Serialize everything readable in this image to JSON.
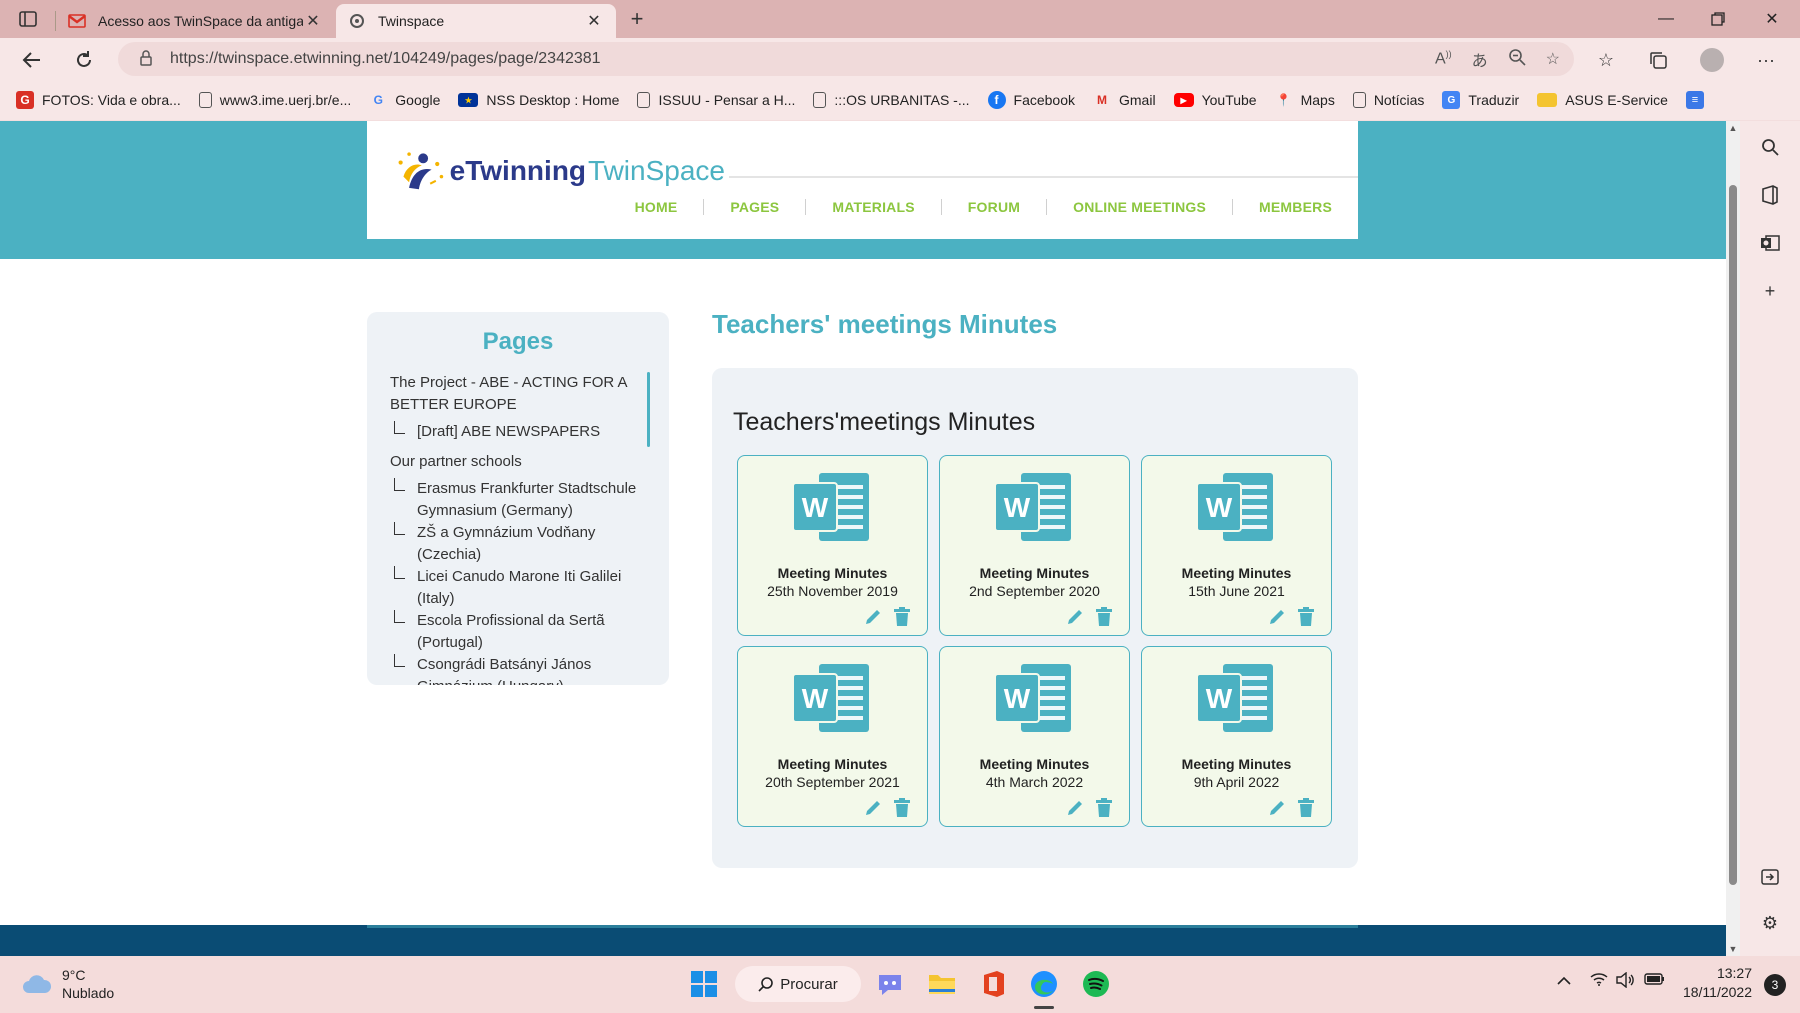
{
  "browser": {
    "tabs": [
      {
        "title": "Acesso aos TwinSpace da antiga",
        "favicon": "gmail-icon",
        "active": false
      },
      {
        "title": "Twinspace",
        "favicon": "twinspace-icon",
        "active": true
      }
    ],
    "url": "https://twinspace.etwinning.net/104249/pages/page/2342381",
    "bookmarks": [
      {
        "label": "FOTOS: Vida e obra...",
        "icon": "g-icon",
        "color": "#d93025"
      },
      {
        "label": "www3.ime.uerj.br/e...",
        "icon": "page-icon",
        "color": "#555555"
      },
      {
        "label": "Google",
        "icon": "google-icon",
        "color": "#4285f4"
      },
      {
        "label": "NSS Desktop : Home",
        "icon": "eu-flag-icon",
        "color": "#003399"
      },
      {
        "label": "ISSUU - Pensar a H...",
        "icon": "page-icon",
        "color": "#555555"
      },
      {
        "label": ":::OS URBANITAS -...",
        "icon": "page-icon",
        "color": "#555555"
      },
      {
        "label": "Facebook",
        "icon": "facebook-icon",
        "color": "#1877f2"
      },
      {
        "label": "Gmail",
        "icon": "gmail-icon",
        "color": "#d93025"
      },
      {
        "label": "YouTube",
        "icon": "youtube-icon",
        "color": "#ff0000"
      },
      {
        "label": "Maps",
        "icon": "maps-icon",
        "color": "#34a853"
      },
      {
        "label": "Notícias",
        "icon": "page-icon",
        "color": "#555555"
      },
      {
        "label": "Traduzir",
        "icon": "translate-icon",
        "color": "#4285f4"
      },
      {
        "label": "ASUS E-Service",
        "icon": "folder-icon",
        "color": "#f4c430"
      }
    ]
  },
  "site": {
    "logo_word1": "eTwinning",
    "logo_word2": "TwinSpace",
    "menu": [
      "HOME",
      "PAGES",
      "MATERIALS",
      "FORUM",
      "ONLINE MEETINGS",
      "MEMBERS"
    ],
    "accent": "#4bb1c2",
    "menu_color": "#8cc63f"
  },
  "sidebar": {
    "title": "Pages",
    "items": [
      {
        "label": "The Project - ABE - ACTING FOR A BETTER EUROPE",
        "level": 0
      },
      {
        "label": "[Draft] ABE NEWSPAPERS",
        "level": 1
      },
      {
        "label": "Our partner schools",
        "level": 0
      },
      {
        "label": "Erasmus Frankfurter Stadtschule Gymnasium (Germany)",
        "level": 1
      },
      {
        "label": "ZŠ a Gymnázium Vodňany (Czechia)",
        "level": 1
      },
      {
        "label": "Licei Canudo Marone Iti Galilei (Italy)",
        "level": 1
      },
      {
        "label": "Escola Profissional da Sertã (Portugal)",
        "level": 1
      },
      {
        "label": "Csongrádi Batsányi János Gimnázium (Hungary)",
        "level": 1
      }
    ]
  },
  "main": {
    "page_title": "Teachers' meetings Minutes",
    "section_heading": "Teachers'meetings Minutes",
    "documents": [
      {
        "title": "Meeting Minutes",
        "date": "25th November 2019"
      },
      {
        "title": "Meeting Minutes",
        "date": "2nd September 2020"
      },
      {
        "title": "Meeting Minutes",
        "date": "15th June 2021"
      },
      {
        "title": "Meeting Minutes",
        "date": "20th September 2021"
      },
      {
        "title": "Meeting Minutes",
        "date": "4th March 2022"
      },
      {
        "title": "Meeting Minutes",
        "date": "9th April 2022"
      }
    ]
  },
  "taskbar": {
    "weather_temp": "9°C",
    "weather_desc": "Nublado",
    "search_label": "Procurar",
    "time": "13:27",
    "date": "18/11/2022",
    "notifications": "3"
  }
}
